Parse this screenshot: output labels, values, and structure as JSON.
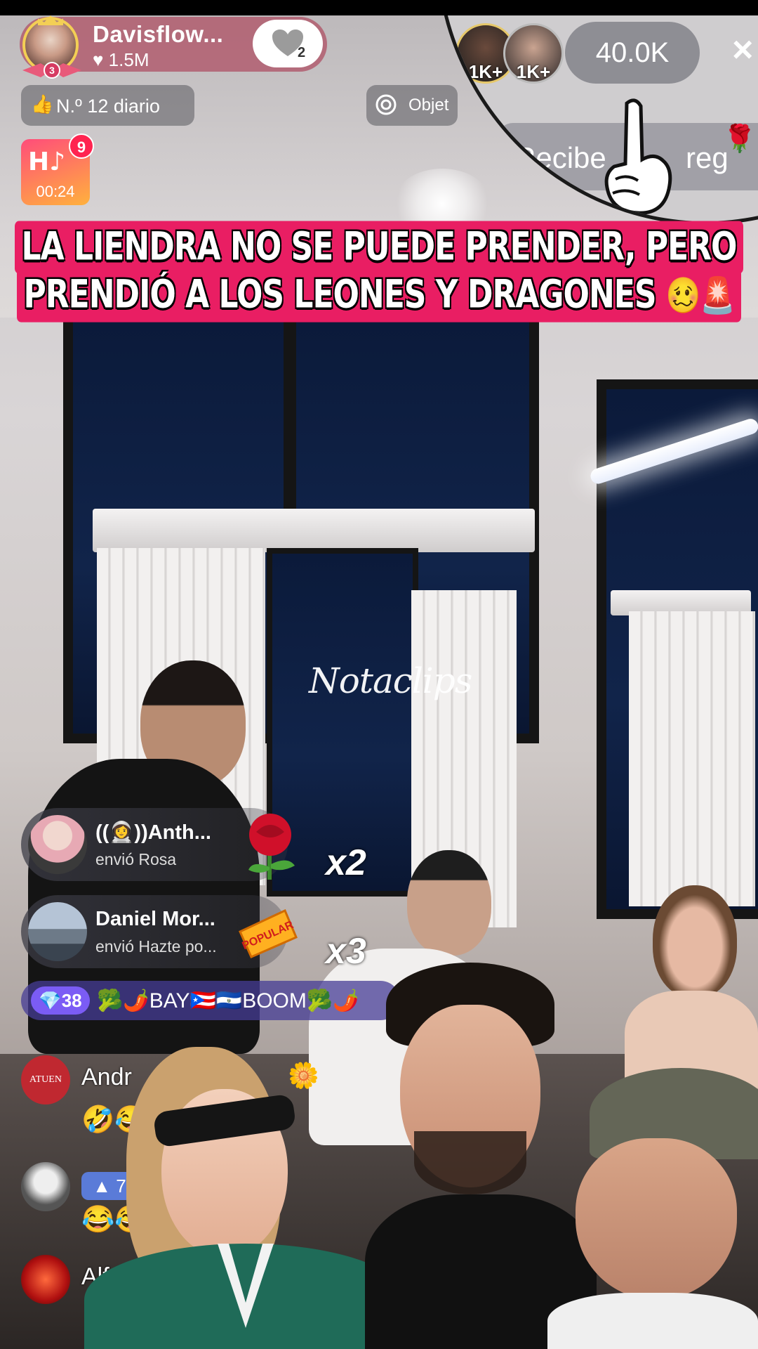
{
  "host": {
    "name": "Davisflow...",
    "likes": "1.5M",
    "follow_count": "2",
    "badge_level": "3"
  },
  "daily_rank": {
    "label": "N.º 12 diario"
  },
  "goal": {
    "label": "Objet"
  },
  "live_badge": {
    "count": "9",
    "timer": "00:24"
  },
  "viewers": {
    "top": [
      {
        "label": "1K+"
      },
      {
        "label": "1K+"
      }
    ],
    "count": "40.0K",
    "close": "×"
  },
  "recibe": {
    "left": "Recibe",
    "right": "reg"
  },
  "headline": {
    "line1": "LA LIENDRA NO SE PUEDE PRENDER, PERO",
    "line2": "PRENDIÓ A LOS LEONES Y DRAGONES",
    "emoji": "🥴🚨"
  },
  "watermark": "Notaclips",
  "gifts": [
    {
      "name": "((👩‍🚀))Anth...",
      "message": "envió Rosa",
      "multiplier": "x2"
    },
    {
      "name": "Daniel Mor...",
      "message": "envió Hazte po...",
      "multiplier": "x3",
      "sticker": "POPULAR"
    }
  ],
  "fan_bar": {
    "level": "38",
    "text": "🥦🌶️BAY🇵🇷🇸🇻BOOM🥦🌶️"
  },
  "comments": [
    {
      "name": "Andr",
      "avatar_text": "ATUEN",
      "reaction": "🤣😂"
    },
    {
      "name": "",
      "badge": "7",
      "reaction": "😂😂"
    },
    {
      "name": "Alf"
    }
  ],
  "colors": {
    "accent_pink": "#e91e63",
    "fan_purple": "#7b5cf5",
    "host_pill": "#af5064"
  }
}
